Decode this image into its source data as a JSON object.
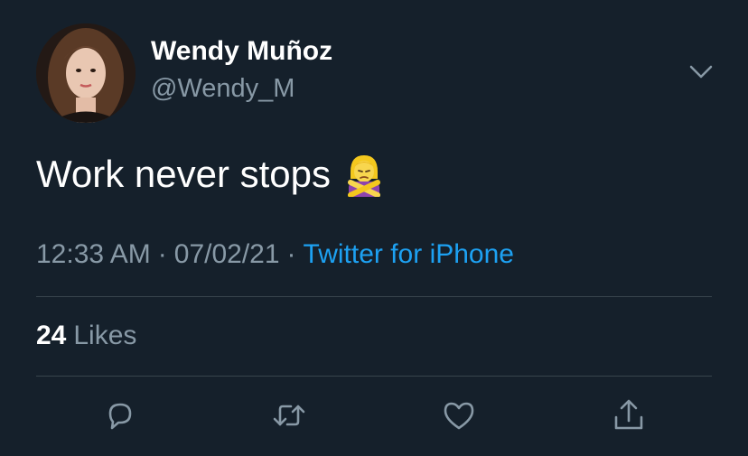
{
  "user": {
    "display_name": "Wendy Muñoz",
    "handle": "@Wendy_M",
    "avatar_icon": "profile-photo"
  },
  "tweet": {
    "text": "Work never stops",
    "emoji_icon": "person-gesturing-no-emoji"
  },
  "meta": {
    "time": "12:33 AM",
    "separator": "·",
    "date": "07/02/21",
    "source": "Twitter for iPhone"
  },
  "stats": {
    "likes_count": "24",
    "likes_label": "Likes"
  },
  "actions": {
    "reply_icon": "reply-icon",
    "retweet_icon": "retweet-icon",
    "like_icon": "heart-icon",
    "share_icon": "share-icon",
    "menu_icon": "chevron-down-icon"
  },
  "colors": {
    "background": "#15202b",
    "text_primary": "#ffffff",
    "text_secondary": "#8899a6",
    "link": "#1da1f2",
    "divider": "#38444d"
  }
}
